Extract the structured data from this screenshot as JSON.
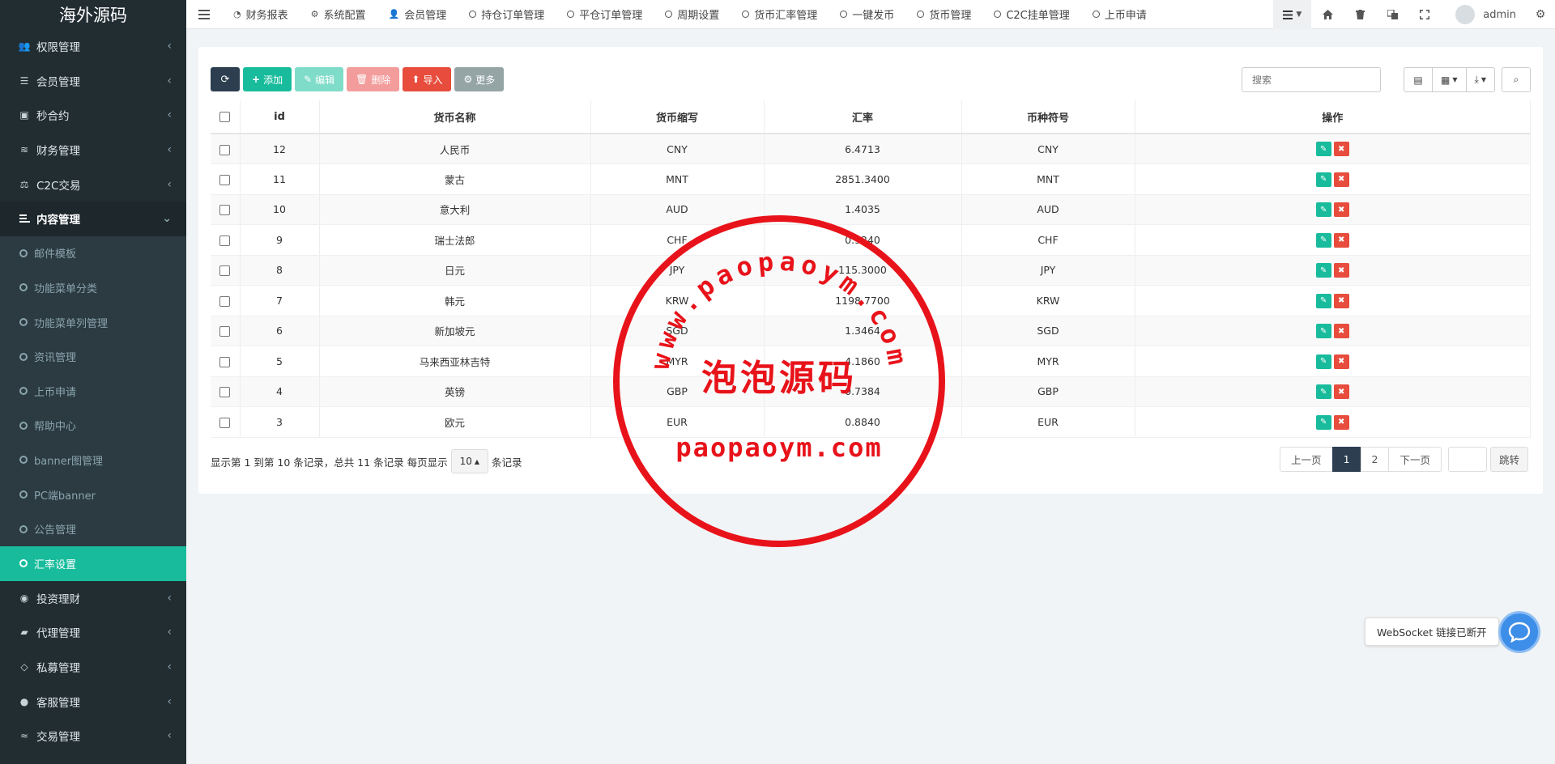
{
  "sidebar": {
    "brand": "海外源码",
    "menu_before": [
      {
        "label": "权限管理",
        "icon": "users-icon"
      },
      {
        "label": "会员管理",
        "icon": "list-icon"
      },
      {
        "label": "秒合约",
        "icon": "calendar-icon"
      },
      {
        "label": "财务管理",
        "icon": "database-icon"
      },
      {
        "label": "C2C交易",
        "icon": "balance-icon"
      }
    ],
    "open_menu": {
      "label": "内容管理",
      "icon": "file-text-icon"
    },
    "submenu": [
      "邮件模板",
      "功能菜单分类",
      "功能菜单列管理",
      "资讯管理",
      "上币申请",
      "帮助中心",
      "banner图管理",
      "PC端banner",
      "公告管理",
      "汇率设置"
    ],
    "active_sub_index": 9,
    "menu_after": [
      {
        "label": "投资理财",
        "icon": "compass-icon"
      },
      {
        "label": "代理管理",
        "icon": "briefcase-icon"
      },
      {
        "label": "私募管理",
        "icon": "diamond-icon"
      },
      {
        "label": "客服管理",
        "icon": "comment-icon"
      },
      {
        "label": "交易管理",
        "icon": "handshake-icon"
      }
    ]
  },
  "topbar": {
    "tabs": [
      {
        "label": "财务报表",
        "icon": "dashboard-icon"
      },
      {
        "label": "系统配置",
        "icon": "cog-icon"
      },
      {
        "label": "会员管理",
        "icon": "user-icon"
      },
      {
        "label": "持仓订单管理",
        "icon": "circle-icon"
      },
      {
        "label": "平仓订单管理",
        "icon": "circle-icon"
      },
      {
        "label": "周期设置",
        "icon": "circle-icon"
      },
      {
        "label": "货币汇率管理",
        "icon": "circle-icon"
      },
      {
        "label": "一键发币",
        "icon": "circle-icon"
      },
      {
        "label": "货币管理",
        "icon": "circle-icon"
      },
      {
        "label": "C2C挂单管理",
        "icon": "circle-icon"
      },
      {
        "label": "上币申请",
        "icon": "circle-icon"
      }
    ],
    "user_name": "admin"
  },
  "toolbar": {
    "add": "添加",
    "edit": "编辑",
    "delete": "删除",
    "import": "导入",
    "more": "更多"
  },
  "search": {
    "placeholder": "搜索"
  },
  "table": {
    "columns": [
      "id",
      "货币名称",
      "货币缩写",
      "汇率",
      "币种符号",
      "操作"
    ],
    "rows": [
      {
        "id": "12",
        "name": "人民币",
        "abbr": "CNY",
        "rate": "6.4713",
        "symbol": "CNY"
      },
      {
        "id": "11",
        "name": "蒙古",
        "abbr": "MNT",
        "rate": "2851.3400",
        "symbol": "MNT"
      },
      {
        "id": "10",
        "name": "意大利",
        "abbr": "AUD",
        "rate": "1.4035",
        "symbol": "AUD"
      },
      {
        "id": "9",
        "name": "瑞士法郎",
        "abbr": "CHF",
        "rate": "0.9240",
        "symbol": "CHF"
      },
      {
        "id": "8",
        "name": "日元",
        "abbr": "JPY",
        "rate": "115.3000",
        "symbol": "JPY"
      },
      {
        "id": "7",
        "name": "韩元",
        "abbr": "KRW",
        "rate": "1198.7700",
        "symbol": "KRW"
      },
      {
        "id": "6",
        "name": "新加坡元",
        "abbr": "SGD",
        "rate": "1.3464",
        "symbol": "SGD"
      },
      {
        "id": "5",
        "name": "马来西亚林吉特",
        "abbr": "MYR",
        "rate": "4.1860",
        "symbol": "MYR"
      },
      {
        "id": "4",
        "name": "英镑",
        "abbr": "GBP",
        "rate": "0.7384",
        "symbol": "GBP"
      },
      {
        "id": "3",
        "name": "欧元",
        "abbr": "EUR",
        "rate": "0.8840",
        "symbol": "EUR"
      }
    ]
  },
  "footer": {
    "info_prefix": "显示第 1 到第 10 条记录，总共 11 条记录 每页显示",
    "page_size": "10",
    "info_suffix": "条记录"
  },
  "pager": {
    "prev": "上一页",
    "pages": [
      "1",
      "2"
    ],
    "active_page": "1",
    "next": "下一页",
    "jump": "跳转"
  },
  "stamp": {
    "arc_text": "www.paopaoym.com",
    "center_text": "泡泡源码",
    "bottom_text": "paopaoym.com",
    "color": "#e8131a"
  },
  "toast": {
    "text": "WebSocket 链接已断开"
  },
  "colors": {
    "sidebar_bg": "#222d32",
    "accent": "#18bc9c",
    "danger": "#e74c3c",
    "dark": "#2c3e50"
  }
}
